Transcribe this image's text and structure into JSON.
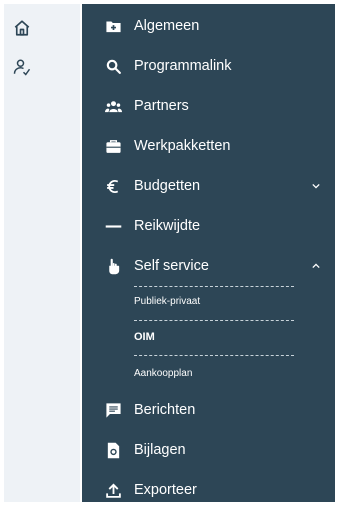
{
  "rail": {
    "icons": [
      "home-icon",
      "user-check-icon"
    ]
  },
  "menu": {
    "items": [
      {
        "label": "Algemeen",
        "icon": "folder-plus-icon"
      },
      {
        "label": "Programmalink",
        "icon": "search-icon"
      },
      {
        "label": "Partners",
        "icon": "users-icon"
      },
      {
        "label": "Werkpakketten",
        "icon": "briefcase-icon"
      },
      {
        "label": "Budgetten",
        "icon": "euro-icon",
        "chevron": "chevron-down-icon"
      },
      {
        "label": "Reikwijdte",
        "icon": "minus-icon"
      },
      {
        "label": "Self service",
        "icon": "hand-pointer-icon",
        "chevron": "chevron-up-icon"
      },
      {
        "label": "Berichten",
        "icon": "message-icon"
      },
      {
        "label": "Bijlagen",
        "icon": "file-icon"
      },
      {
        "label": "Exporteer",
        "icon": "upload-icon"
      }
    ],
    "self_service_sub": [
      {
        "label": "Publiek-privaat",
        "active": false
      },
      {
        "label": "OIM",
        "active": true
      },
      {
        "label": "Aankoopplan",
        "active": false
      }
    ]
  },
  "colors": {
    "panel": "#2d4656",
    "rail": "#eef2f6",
    "text": "#ffffff"
  }
}
